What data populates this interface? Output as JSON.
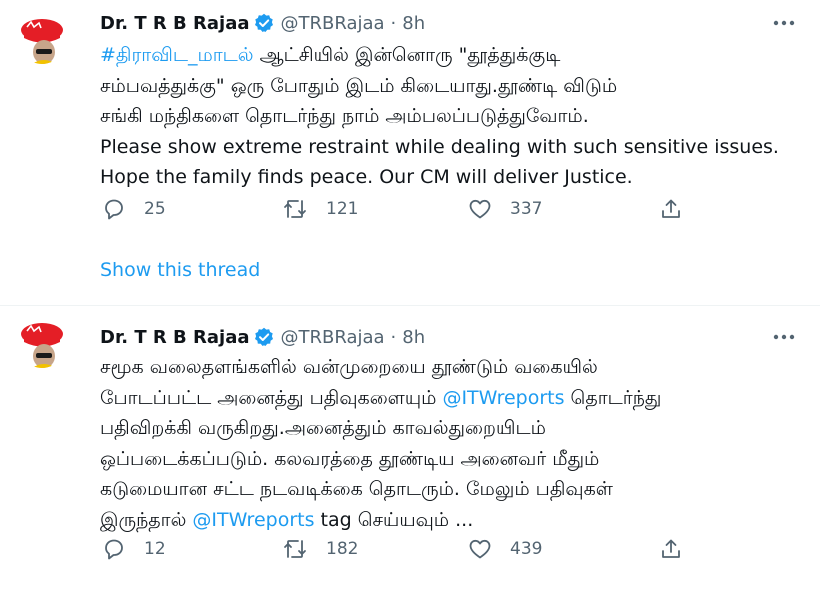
{
  "colors": {
    "accent": "#1d9bf0",
    "muted": "#536471",
    "text": "#0f1419",
    "divider": "#eff3f4",
    "avatar_red": "#e41e26"
  },
  "tweets": [
    {
      "author_name": "Dr. T R B Rajaa",
      "handle": "@TRBRajaa",
      "separator": "·",
      "time": "8h",
      "avatar_icon": "profile-avatar",
      "hashtag": "#திராவிட_மாடல்",
      "text_a": " ஆட்சியில் இன்னொரு \"தூத்துக்குடி\nசம்பவத்துக்கு\" ஒரு போதும் இடம் கிடையாது.தூண்டி விடும்\nசங்கி மந்திகளை தொடர்ந்து நாம் அம்பலப்படுத்துவோம்.\nPlease show extreme restraint while dealing with such sensitive issues.\nHope the family finds peace. Our CM will deliver Justice.",
      "replies": "25",
      "retweets": "121",
      "likes": "337",
      "show_thread": "Show this thread"
    },
    {
      "author_name": "Dr. T R B Rajaa",
      "handle": "@TRBRajaa",
      "separator": "·",
      "time": "8h",
      "avatar_icon": "profile-avatar",
      "text_a": "சமூக வலைதளங்களில் வன்முறையை தூண்டும் வகையில்\nபோடப்பட்ட அனைத்து பதிவுகளையும் ",
      "mention_1": "@ITWreports",
      "text_b": " தொடர்ந்து\nபதிவிறக்கி வருகிறது.அனைத்தும் காவல்துறையிடம்\nஒப்படைக்கப்படும். கலவரத்தை தூண்டிய அனைவர் மீதும்\nகடுமையான சட்ட நடவடிக்கை தொடரும். மேலும் பதிவுகள்\nஇருந்தால் ",
      "mention_2": "@ITWreports",
      "text_c": " tag செய்யவும் ...",
      "replies": "12",
      "retweets": "182",
      "likes": "439"
    }
  ]
}
